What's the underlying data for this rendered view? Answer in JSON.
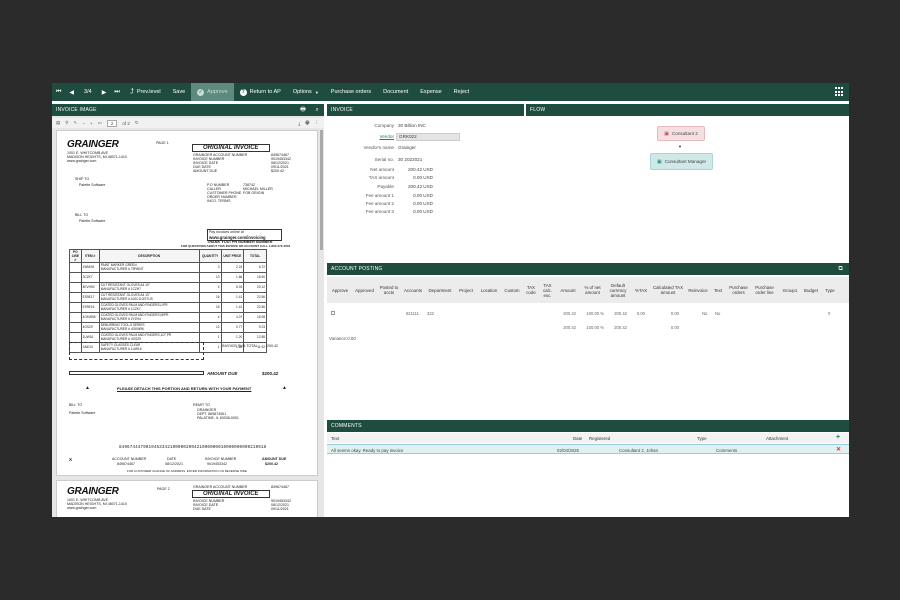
{
  "toolbar": {
    "counter": "3/4",
    "prev_level": "Prev.level",
    "save": "Save",
    "approve": "Approve",
    "return_to_ap": "Return to AP",
    "options": "Options",
    "purchase_orders": "Purchase orders",
    "document": "Document",
    "expense": "Expense",
    "reject": "Reject"
  },
  "invoice_image": {
    "title": "INVOICE IMAGE",
    "page_num": "2",
    "page_total": "of 2",
    "doc": {
      "logo": "GRAINGER",
      "page_label": "PAGE 1",
      "original_invoice": "ORIGINAL INVOICE",
      "company_addr": [
        "1001 E. WHITCOMB AVE",
        "MADISON HEIGHTS, MI  48071-1410",
        "www.grainger.com"
      ],
      "header_labels": [
        "GRAINGER ACCOUNT NUMBER",
        "INVOICE NUMBER",
        "INVOICE DATE",
        "DUE DATE",
        "AMOUNT DUE"
      ],
      "header_values": [
        "849674467",
        "9019453342",
        "08/12/2021",
        "09/11/2021",
        "$200.42"
      ],
      "ship_to": "SHIP TO",
      "ship_name": "Palette Software",
      "bill_to": "BILL TO",
      "bill_name": "Palette Software",
      "po_labels": [
        "P.O NUMBER",
        "CALLER",
        "CUSTOMER PHONE",
        "ORDER NUMBER",
        "INCO. TERMS"
      ],
      "po_values": [
        "738742",
        "MICHAEL MILLER",
        "",
        "",
        "FOB ORIGIN"
      ],
      "pay_online": "Pay invoices online at",
      "pay_url": "www.grainger.com/invoicing",
      "thank_you": "THANK YOU!   PH NUMBER   NUMBER",
      "questions": "FOR QUESTIONS ABOUT THIS INVOICE OR ACCOUNT CALL 1-800-472-4643",
      "table_headers": [
        "PO LINE #",
        "ITEM #",
        "DESCRIPTION",
        "QUANTITY",
        "UNIT PRICE",
        "TOTAL"
      ],
      "table_rows": [
        [
          "",
          "1WMX8",
          "PAINT MARKER GREEN\nMANUFACTURER # 79PAINT",
          "3",
          "2.24",
          "6.72"
        ],
        [
          "",
          "3CZK7",
          "",
          "10",
          "1.66",
          "16.60"
        ],
        [
          "",
          "4EVH50",
          "CUT RESISTANT GLOVES A4 10\"\nMANUFACTURER # 1CZH7",
          "4",
          "5.03",
          "20.12"
        ],
        [
          "",
          "ES9E17",
          "CUT RESISTANT GLOVES A4 10\"\nMANUFACTURER # AJ0C11GSTUS",
          "16",
          "1.41",
          "22.56"
        ],
        [
          "",
          "ES9E16",
          "COATED GLOVES PALM AND FINGERS,L/PR\nMANUFACTURER # 1CZK7",
          "16",
          "1.41",
          "22.56"
        ],
        [
          "",
          "4GKW96",
          "COATED GLOVES PALM AND FINGERS,M/PR\nMANUFACTURER # 2YZH4",
          "4",
          "4.07",
          "16.08"
        ],
        [
          "",
          "4GSZ9",
          "DEBURRING TOOL,5 SERIES\nMANUFACTURER # 4GKW96",
          "12",
          "0.77",
          "9.23"
        ],
        [
          "",
          "1UW16",
          "COATED GLOVES PALM AND FINGERS,1/2\",PR\nMANUFACTURER # 4GSZ9",
          "1",
          "1.20",
          "12.88"
        ],
        [
          "",
          "1AIE10",
          "SAFETY GLASSES CLEAR\nMANUFACTURER # 1UW16",
          "1",
          "1.28",
          "11.92"
        ]
      ],
      "subtotal_label": "INVOICE SUB-TOTAL",
      "subtotal_value": "200.42",
      "amount_due_label": "AMOUNT DUE",
      "amount_due_value": "$200.42",
      "detach": "PLEASE DETACH THIS PORTION AND RETURN WITH YOUR PAYMENT",
      "remit_to": "REMIT TO",
      "remit_lines": [
        "GRAINGER",
        "DEPT. 869874061",
        "PALATINE, IL  60038-0001"
      ],
      "micr": "8496744479019453342100000200421000000010000000000210918",
      "stub_labels": [
        "ACCOUNT NUMBER",
        "DATE",
        "INVOICE NUMBER",
        "AMOUNT DUE"
      ],
      "stub_values": [
        "849674467",
        "08/12/2021",
        "9019453342",
        "$200.42"
      ],
      "stub_x": "X",
      "footer": "FOR CUSTOMER CHANGE OF ADDRESS, ENTER INFORMATION ON REVERSE SIDE",
      "page2_label": "PAGE 2",
      "page2_header_labels": [
        "GRAINGER ACCOUNT NUMBER",
        "INVOICE NUMBER",
        "INVOICE DATE",
        "DUE DATE"
      ],
      "page2_header_values": [
        "849674467",
        "9019453342",
        "08/12/2021",
        "09/11/2021"
      ]
    }
  },
  "invoice": {
    "title": "INVOICE",
    "fields": [
      {
        "label": "Company",
        "value": "30 Billion INC"
      },
      {
        "label": "Vendor",
        "value": "GRK022"
      },
      {
        "label": "Vendor's name",
        "value": "Grainger"
      },
      {
        "label": "Serial no.",
        "value": "30 2022021"
      },
      {
        "label": "Net amount",
        "value": "200.42 USD"
      },
      {
        "label": "TAX amount",
        "value": "0.00 USD"
      },
      {
        "label": "Payable",
        "value": "200.42 USD"
      },
      {
        "label": "Fee amount 1",
        "value": "0.00 USD"
      },
      {
        "label": "Fee amount 2",
        "value": "0.00 USD"
      },
      {
        "label": "Fee amount 3",
        "value": "0.00 USD"
      }
    ]
  },
  "flow": {
    "title": "FLOW",
    "node1": "Consultant 2",
    "node2": "Consultant Manager"
  },
  "posting": {
    "title": "ACCOUNT POSTING",
    "headers": [
      "Approve",
      "Approved",
      "Posted to accts",
      "Accounts",
      "Department",
      "Project",
      "Location",
      "Custom",
      "TAX code",
      "TAX calc. exc.",
      "Amount",
      "% of net amount",
      "Default currency amount",
      "%TAX",
      "Calculated TAX amount",
      "Reinvoice",
      "Text",
      "Purchase orders",
      "Purchase order line",
      "Group1",
      "Budget",
      "Type"
    ],
    "row": {
      "accounts": "621111",
      "department": "322",
      "amount": "200.42",
      "pct": "100.00 %",
      "default_amount": "200.42",
      "tax_pct": "0.00",
      "calc_tax": "0.00",
      "reinvoice": "No",
      "text": "No",
      "type": "0"
    },
    "totals": {
      "amount": "200.42",
      "pct": "100.00 %",
      "default_amount": "200.42",
      "calc_tax": "0.00"
    },
    "variance": "Variance:0.00"
  },
  "comments": {
    "title": "COMMENTS",
    "headers": {
      "text": "Text",
      "date": "Date",
      "registered": "Registered",
      "type": "Type",
      "attachment": "Attachment"
    },
    "rows": [
      {
        "text": "All seems okay. Ready to pay invoice",
        "date": "02/04/2025",
        "registered": "Consultant 2, Johan",
        "type": "Comments"
      }
    ]
  },
  "colors": {
    "header": "#1e4d40",
    "active": "#5c8a7c",
    "row_highlight": "#dff2f0",
    "node1": "#f6dfe1",
    "node2": "#cfe9e8"
  }
}
